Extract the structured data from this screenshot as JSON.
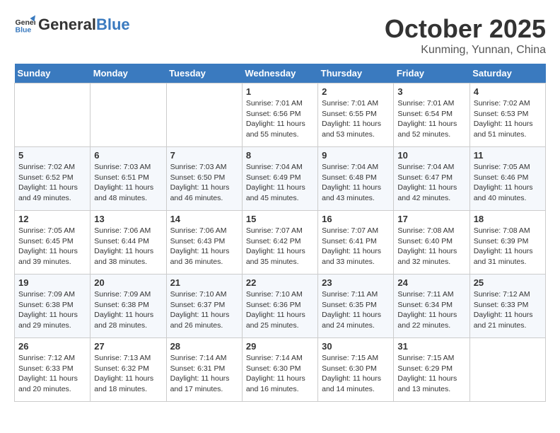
{
  "header": {
    "logo_line1": "General",
    "logo_line2": "Blue",
    "month": "October 2025",
    "location": "Kunming, Yunnan, China"
  },
  "weekdays": [
    "Sunday",
    "Monday",
    "Tuesday",
    "Wednesday",
    "Thursday",
    "Friday",
    "Saturday"
  ],
  "weeks": [
    [
      {
        "day": "",
        "info": ""
      },
      {
        "day": "",
        "info": ""
      },
      {
        "day": "",
        "info": ""
      },
      {
        "day": "1",
        "info": "Sunrise: 7:01 AM\nSunset: 6:56 PM\nDaylight: 11 hours and 55 minutes."
      },
      {
        "day": "2",
        "info": "Sunrise: 7:01 AM\nSunset: 6:55 PM\nDaylight: 11 hours and 53 minutes."
      },
      {
        "day": "3",
        "info": "Sunrise: 7:01 AM\nSunset: 6:54 PM\nDaylight: 11 hours and 52 minutes."
      },
      {
        "day": "4",
        "info": "Sunrise: 7:02 AM\nSunset: 6:53 PM\nDaylight: 11 hours and 51 minutes."
      }
    ],
    [
      {
        "day": "5",
        "info": "Sunrise: 7:02 AM\nSunset: 6:52 PM\nDaylight: 11 hours and 49 minutes."
      },
      {
        "day": "6",
        "info": "Sunrise: 7:03 AM\nSunset: 6:51 PM\nDaylight: 11 hours and 48 minutes."
      },
      {
        "day": "7",
        "info": "Sunrise: 7:03 AM\nSunset: 6:50 PM\nDaylight: 11 hours and 46 minutes."
      },
      {
        "day": "8",
        "info": "Sunrise: 7:04 AM\nSunset: 6:49 PM\nDaylight: 11 hours and 45 minutes."
      },
      {
        "day": "9",
        "info": "Sunrise: 7:04 AM\nSunset: 6:48 PM\nDaylight: 11 hours and 43 minutes."
      },
      {
        "day": "10",
        "info": "Sunrise: 7:04 AM\nSunset: 6:47 PM\nDaylight: 11 hours and 42 minutes."
      },
      {
        "day": "11",
        "info": "Sunrise: 7:05 AM\nSunset: 6:46 PM\nDaylight: 11 hours and 40 minutes."
      }
    ],
    [
      {
        "day": "12",
        "info": "Sunrise: 7:05 AM\nSunset: 6:45 PM\nDaylight: 11 hours and 39 minutes."
      },
      {
        "day": "13",
        "info": "Sunrise: 7:06 AM\nSunset: 6:44 PM\nDaylight: 11 hours and 38 minutes."
      },
      {
        "day": "14",
        "info": "Sunrise: 7:06 AM\nSunset: 6:43 PM\nDaylight: 11 hours and 36 minutes."
      },
      {
        "day": "15",
        "info": "Sunrise: 7:07 AM\nSunset: 6:42 PM\nDaylight: 11 hours and 35 minutes."
      },
      {
        "day": "16",
        "info": "Sunrise: 7:07 AM\nSunset: 6:41 PM\nDaylight: 11 hours and 33 minutes."
      },
      {
        "day": "17",
        "info": "Sunrise: 7:08 AM\nSunset: 6:40 PM\nDaylight: 11 hours and 32 minutes."
      },
      {
        "day": "18",
        "info": "Sunrise: 7:08 AM\nSunset: 6:39 PM\nDaylight: 11 hours and 31 minutes."
      }
    ],
    [
      {
        "day": "19",
        "info": "Sunrise: 7:09 AM\nSunset: 6:38 PM\nDaylight: 11 hours and 29 minutes."
      },
      {
        "day": "20",
        "info": "Sunrise: 7:09 AM\nSunset: 6:38 PM\nDaylight: 11 hours and 28 minutes."
      },
      {
        "day": "21",
        "info": "Sunrise: 7:10 AM\nSunset: 6:37 PM\nDaylight: 11 hours and 26 minutes."
      },
      {
        "day": "22",
        "info": "Sunrise: 7:10 AM\nSunset: 6:36 PM\nDaylight: 11 hours and 25 minutes."
      },
      {
        "day": "23",
        "info": "Sunrise: 7:11 AM\nSunset: 6:35 PM\nDaylight: 11 hours and 24 minutes."
      },
      {
        "day": "24",
        "info": "Sunrise: 7:11 AM\nSunset: 6:34 PM\nDaylight: 11 hours and 22 minutes."
      },
      {
        "day": "25",
        "info": "Sunrise: 7:12 AM\nSunset: 6:33 PM\nDaylight: 11 hours and 21 minutes."
      }
    ],
    [
      {
        "day": "26",
        "info": "Sunrise: 7:12 AM\nSunset: 6:33 PM\nDaylight: 11 hours and 20 minutes."
      },
      {
        "day": "27",
        "info": "Sunrise: 7:13 AM\nSunset: 6:32 PM\nDaylight: 11 hours and 18 minutes."
      },
      {
        "day": "28",
        "info": "Sunrise: 7:14 AM\nSunset: 6:31 PM\nDaylight: 11 hours and 17 minutes."
      },
      {
        "day": "29",
        "info": "Sunrise: 7:14 AM\nSunset: 6:30 PM\nDaylight: 11 hours and 16 minutes."
      },
      {
        "day": "30",
        "info": "Sunrise: 7:15 AM\nSunset: 6:30 PM\nDaylight: 11 hours and 14 minutes."
      },
      {
        "day": "31",
        "info": "Sunrise: 7:15 AM\nSunset: 6:29 PM\nDaylight: 11 hours and 13 minutes."
      },
      {
        "day": "",
        "info": ""
      }
    ]
  ]
}
